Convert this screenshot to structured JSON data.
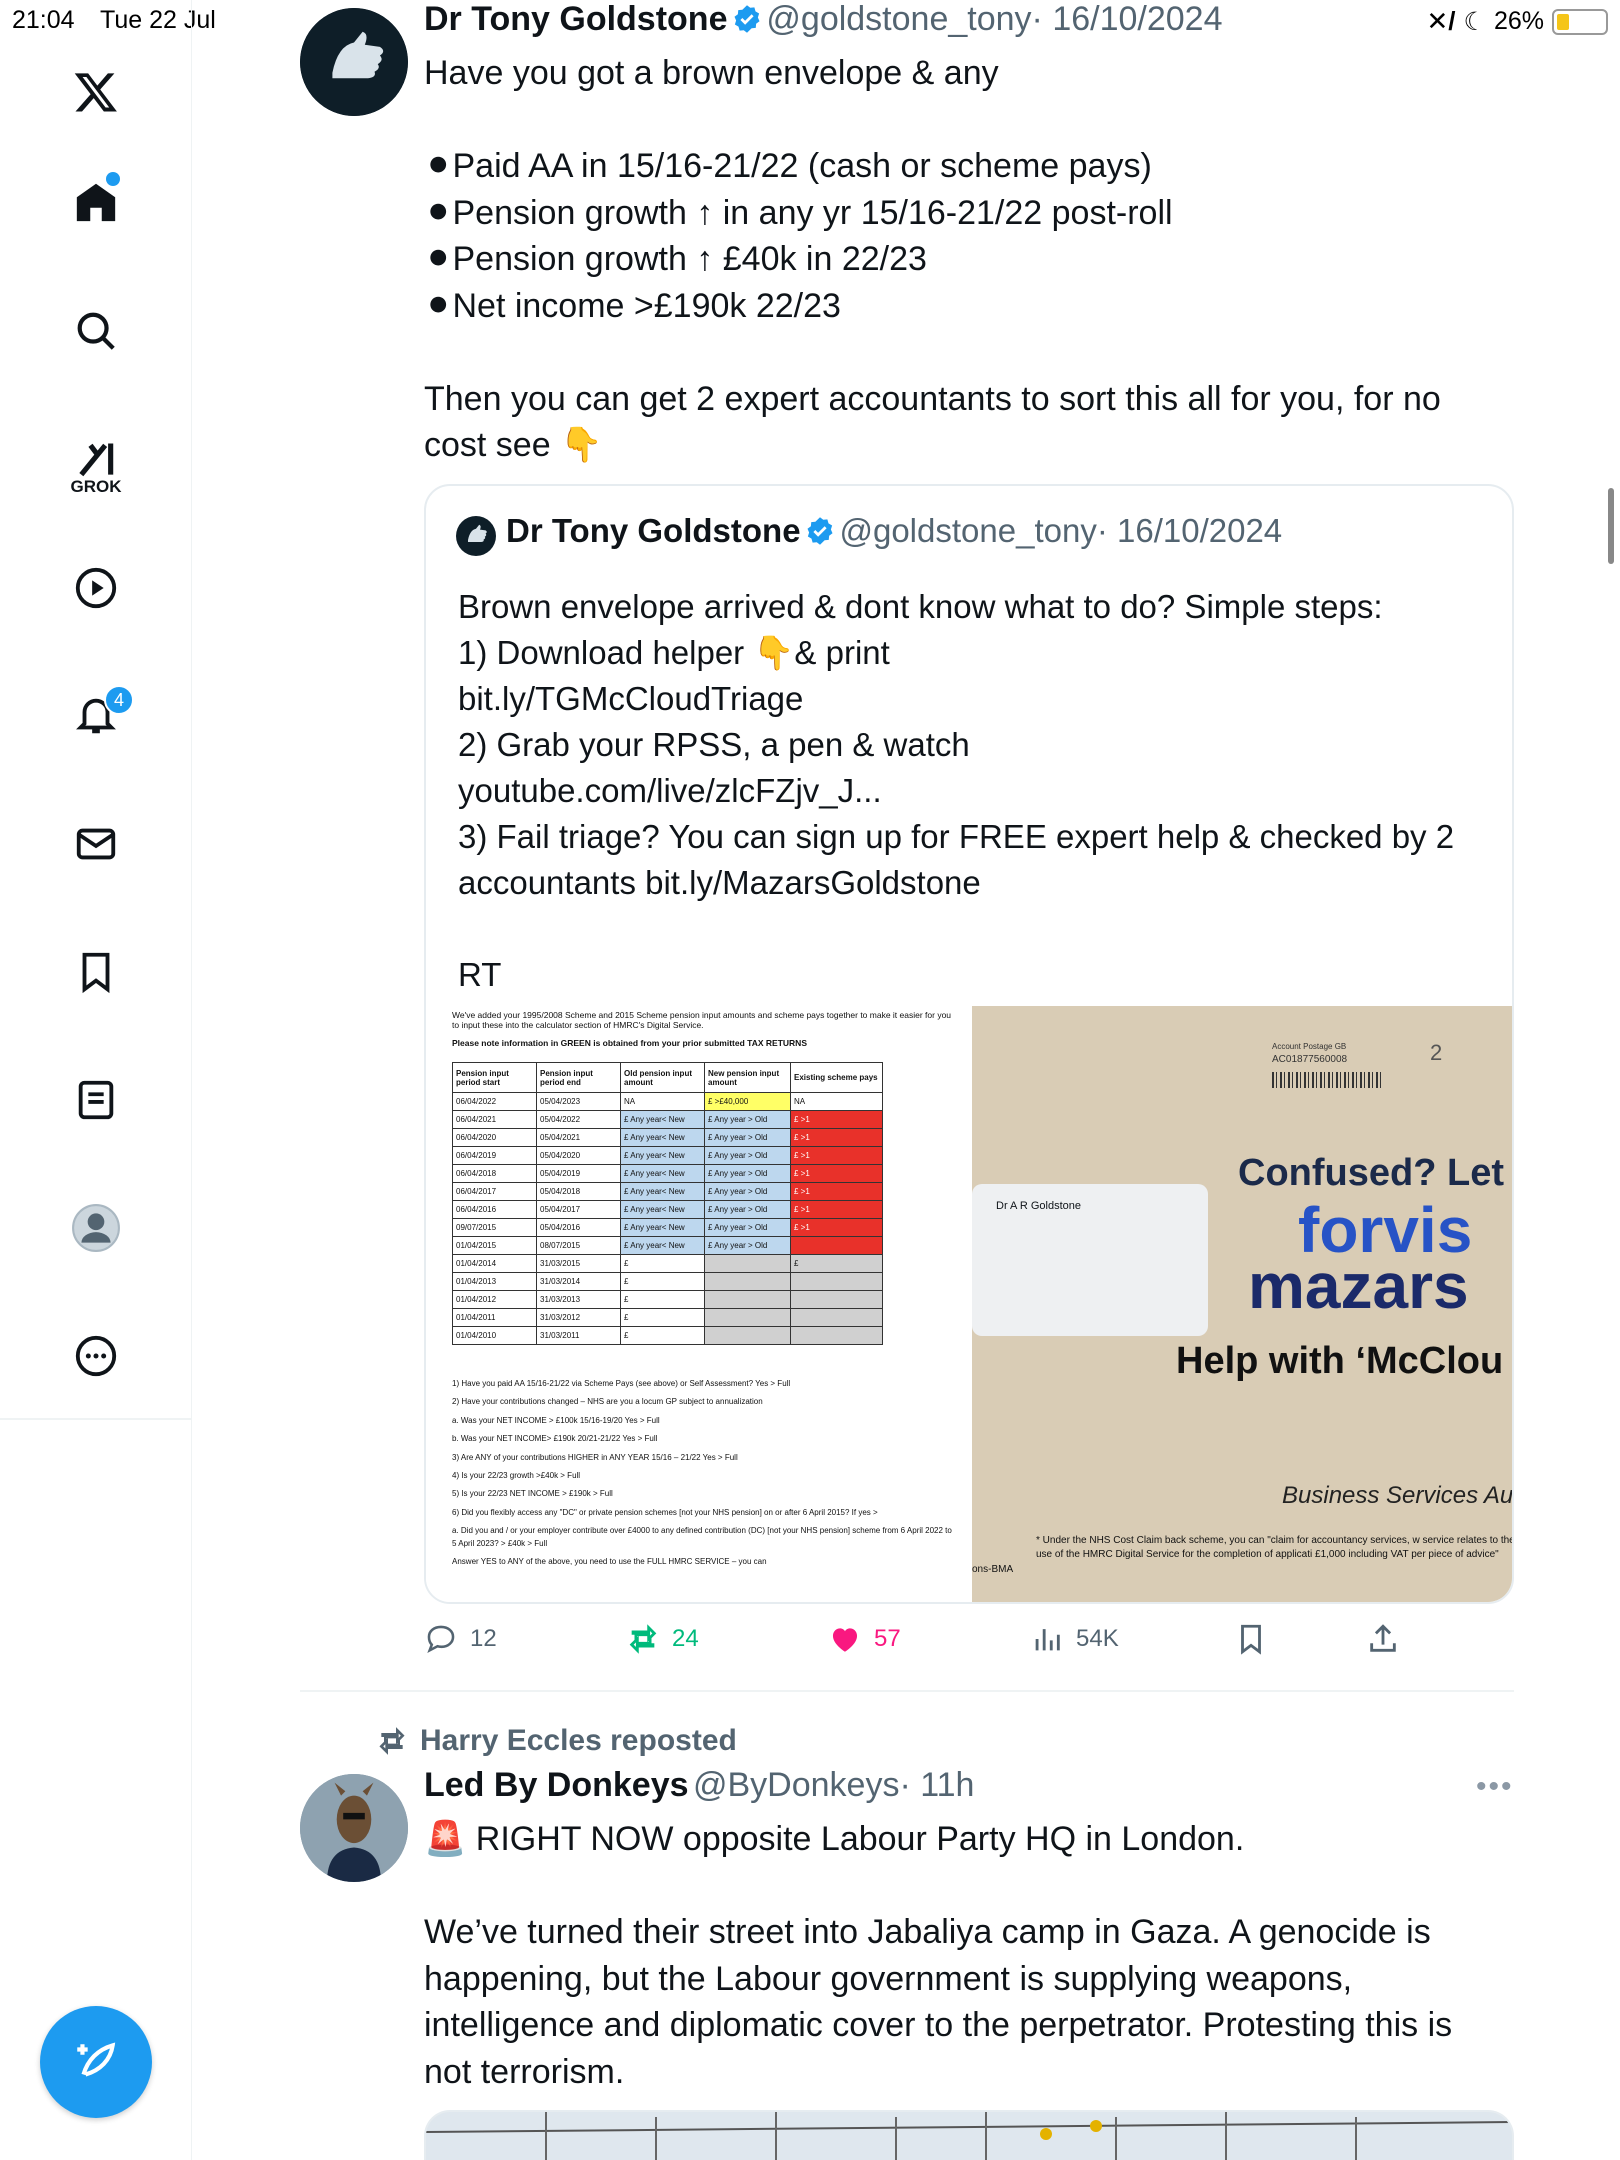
{
  "status_bar": {
    "time": "21:04",
    "date": "Tue 22 Jul",
    "battery": "26%",
    "battery_level": 0.26
  },
  "sidebar": {
    "items": [
      "home",
      "explore",
      "grok",
      "video",
      "notifications",
      "messages",
      "bookmarks",
      "lists",
      "profile",
      "more"
    ],
    "grok_label": "GROK",
    "notifications_badge": "4"
  },
  "tweet1": {
    "name": "Dr Tony Goldstone",
    "handle": "@goldstone_tony",
    "date": "· 16/10/2024",
    "text": "Have you got a brown envelope & any\n\n⚫Paid AA in 15/16-21/22 (cash or scheme pays)\n⚫Pension growth ↑ in any yr 15/16-21/22 post-roll\n⚫Pension growth ↑ £40k in 22/23\n⚫Net income >£190k 22/23\n\nThen you can get 2 expert accountants to sort this all for you, for no cost see 👇",
    "quote": {
      "name": "Dr Tony Goldstone",
      "handle": "@goldstone_tony",
      "date": "· 16/10/2024",
      "text": "Brown envelope arrived & dont know what to do? Simple steps:\n1) Download helper 👇& print\nbit.ly/TGMcCloudTriage\n2) Grab your RPSS, a pen & watch\nyoutube.com/live/zlcFZjv_J...\n3) Fail triage? You can sign up for FREE expert help & checked by 2 accountants bit.ly/MazarsGoldstone\n\nRT",
      "doc": {
        "intro": "We've added your 1995/2008 Scheme and 2015 Scheme pension input amounts and scheme pays together to make it easier for you to input these into the calculator section of HMRC's Digital Service.",
        "note": "Please note information in GREEN is obtained from your prior submitted TAX RETURNS",
        "headers": [
          "Pension input period start",
          "Pension input period end",
          "Old pension input amount",
          "New pension input amount",
          "Existing scheme pays"
        ],
        "rows": [
          [
            "06/04/2022",
            "05/04/2023",
            "NA",
            "£ >£40,000",
            "NA"
          ],
          [
            "06/04/2021",
            "05/04/2022",
            "£ Any year< New",
            "£ Any year > Old",
            "£ >1"
          ],
          [
            "06/04/2020",
            "05/04/2021",
            "£ Any year< New",
            "£ Any year > Old",
            "£ >1"
          ],
          [
            "06/04/2019",
            "05/04/2020",
            "£ Any year< New",
            "£ Any year > Old",
            "£ >1"
          ],
          [
            "06/04/2018",
            "05/04/2019",
            "£ Any year< New",
            "£ Any year > Old",
            "£ >1"
          ],
          [
            "06/04/2017",
            "05/04/2018",
            "£ Any year< New",
            "£ Any year > Old",
            "£ >1"
          ],
          [
            "06/04/2016",
            "05/04/2017",
            "£ Any year< New",
            "£ Any year > Old",
            "£ >1"
          ],
          [
            "09/07/2015",
            "05/04/2016",
            "£ Any year< New",
            "£ Any year > Old",
            "£ >1"
          ],
          [
            "01/04/2015",
            "08/07/2015",
            "£ Any year< New",
            "£ Any year > Old",
            ""
          ],
          [
            "01/04/2014",
            "31/03/2015",
            "£",
            "",
            "£"
          ],
          [
            "01/04/2013",
            "31/03/2014",
            "£",
            "",
            ""
          ],
          [
            "01/04/2012",
            "31/03/2013",
            "£",
            "",
            ""
          ],
          [
            "01/04/2011",
            "31/03/2012",
            "£",
            "",
            ""
          ],
          [
            "01/04/2010",
            "31/03/2011",
            "£",
            "",
            ""
          ]
        ],
        "questions": [
          "1) Have you paid AA 15/16-21/22 via Scheme Pays (see above) or Self Assessment? Yes > Full",
          "2) Have your contributions changed – NHS are you a locum GP subject to annualization",
          "a. Was your NET INCOME > £100k 15/16-19/20 Yes > Full",
          "b. Was your NET INCOME> £190k 20/21-21/22 Yes > Full",
          "3) Are ANY of your contributions HIGHER in ANY YEAR 15/16 – 21/22 Yes > Full",
          "4) Is your 22/23 growth >£40k > Full",
          "5) Is your 22/23 NET INCOME > £190k > Full",
          "6) Did you flexibly access any \"DC\" or private pension schemes [not your NHS pension] on or after 6 April 2015? If yes >",
          "a. Did you and / or your employer contribute over £4000 to any defined contribution (DC) [not your NHS pension] scheme from 6 April 2022 to 5 April 2023? > £40k > Full",
          "Answer YES to ANY of the above, you need to use the FULL HMRC SERVICE – you can"
        ]
      },
      "envelope": {
        "postage": "Account Postage GB",
        "postage_code": "AC01877560008",
        "postage_num": "2",
        "recipient": "Dr A R Goldstone",
        "headline": "Confused? Let",
        "brand1": "forvis",
        "brand2": "mazars",
        "help": "Help with ‘McClou",
        "bsa": "Business Services Auth",
        "footnote": "* Under the NHS Cost Claim back scheme, you can \"claim for accountancy services, w service relates to the use of the HMRC Digital Service for the completion of applicati £1,000 including VAT per piece of advice\"",
        "side": "ons-BMA"
      }
    },
    "actions": {
      "replies": "12",
      "reposts": "24",
      "likes": "57",
      "views": "54K"
    }
  },
  "tweet2": {
    "reposted_by": "Harry Eccles reposted",
    "name": "Led By Donkeys",
    "handle": "@ByDonkeys",
    "date": "· 11h",
    "text": "🚨 RIGHT NOW opposite Labour Party HQ in London.\n\nWe’ve turned their street into Jabaliya camp in Gaza. A genocide is happening, but the Labour government is supplying weapons, intelligence and diplomatic cover to the perpetrator. Protesting this is not terrorism."
  },
  "colors": {
    "accent": "#1d9bf0",
    "like": "#f91880",
    "repost": "#00ba7c",
    "muted": "#536471"
  }
}
